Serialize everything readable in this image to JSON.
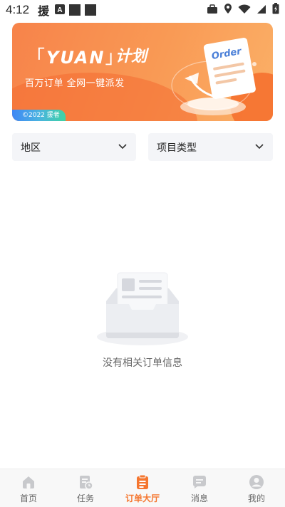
{
  "status_bar": {
    "time": "4:12",
    "app_glyph": "援"
  },
  "banner": {
    "brand": "YUAN",
    "plan": "计划",
    "subtitle": "百万订单  全网一键派发",
    "copyright": "©2022 援者",
    "art_label": "Order"
  },
  "filters": {
    "region": "地区",
    "project_type": "项目类型"
  },
  "empty_state": {
    "message": "没有相关订单信息"
  },
  "bottom_nav": {
    "items": [
      {
        "label": "首页",
        "icon": "home-icon"
      },
      {
        "label": "任务",
        "icon": "task-icon"
      },
      {
        "label": "订单大厅",
        "icon": "order-hall-icon",
        "active": true
      },
      {
        "label": "消息",
        "icon": "message-icon"
      },
      {
        "label": "我的",
        "icon": "profile-icon"
      }
    ]
  },
  "colors": {
    "accent": "#f5762f",
    "inactive": "#666666",
    "filter_bg": "#f4f5f8"
  }
}
